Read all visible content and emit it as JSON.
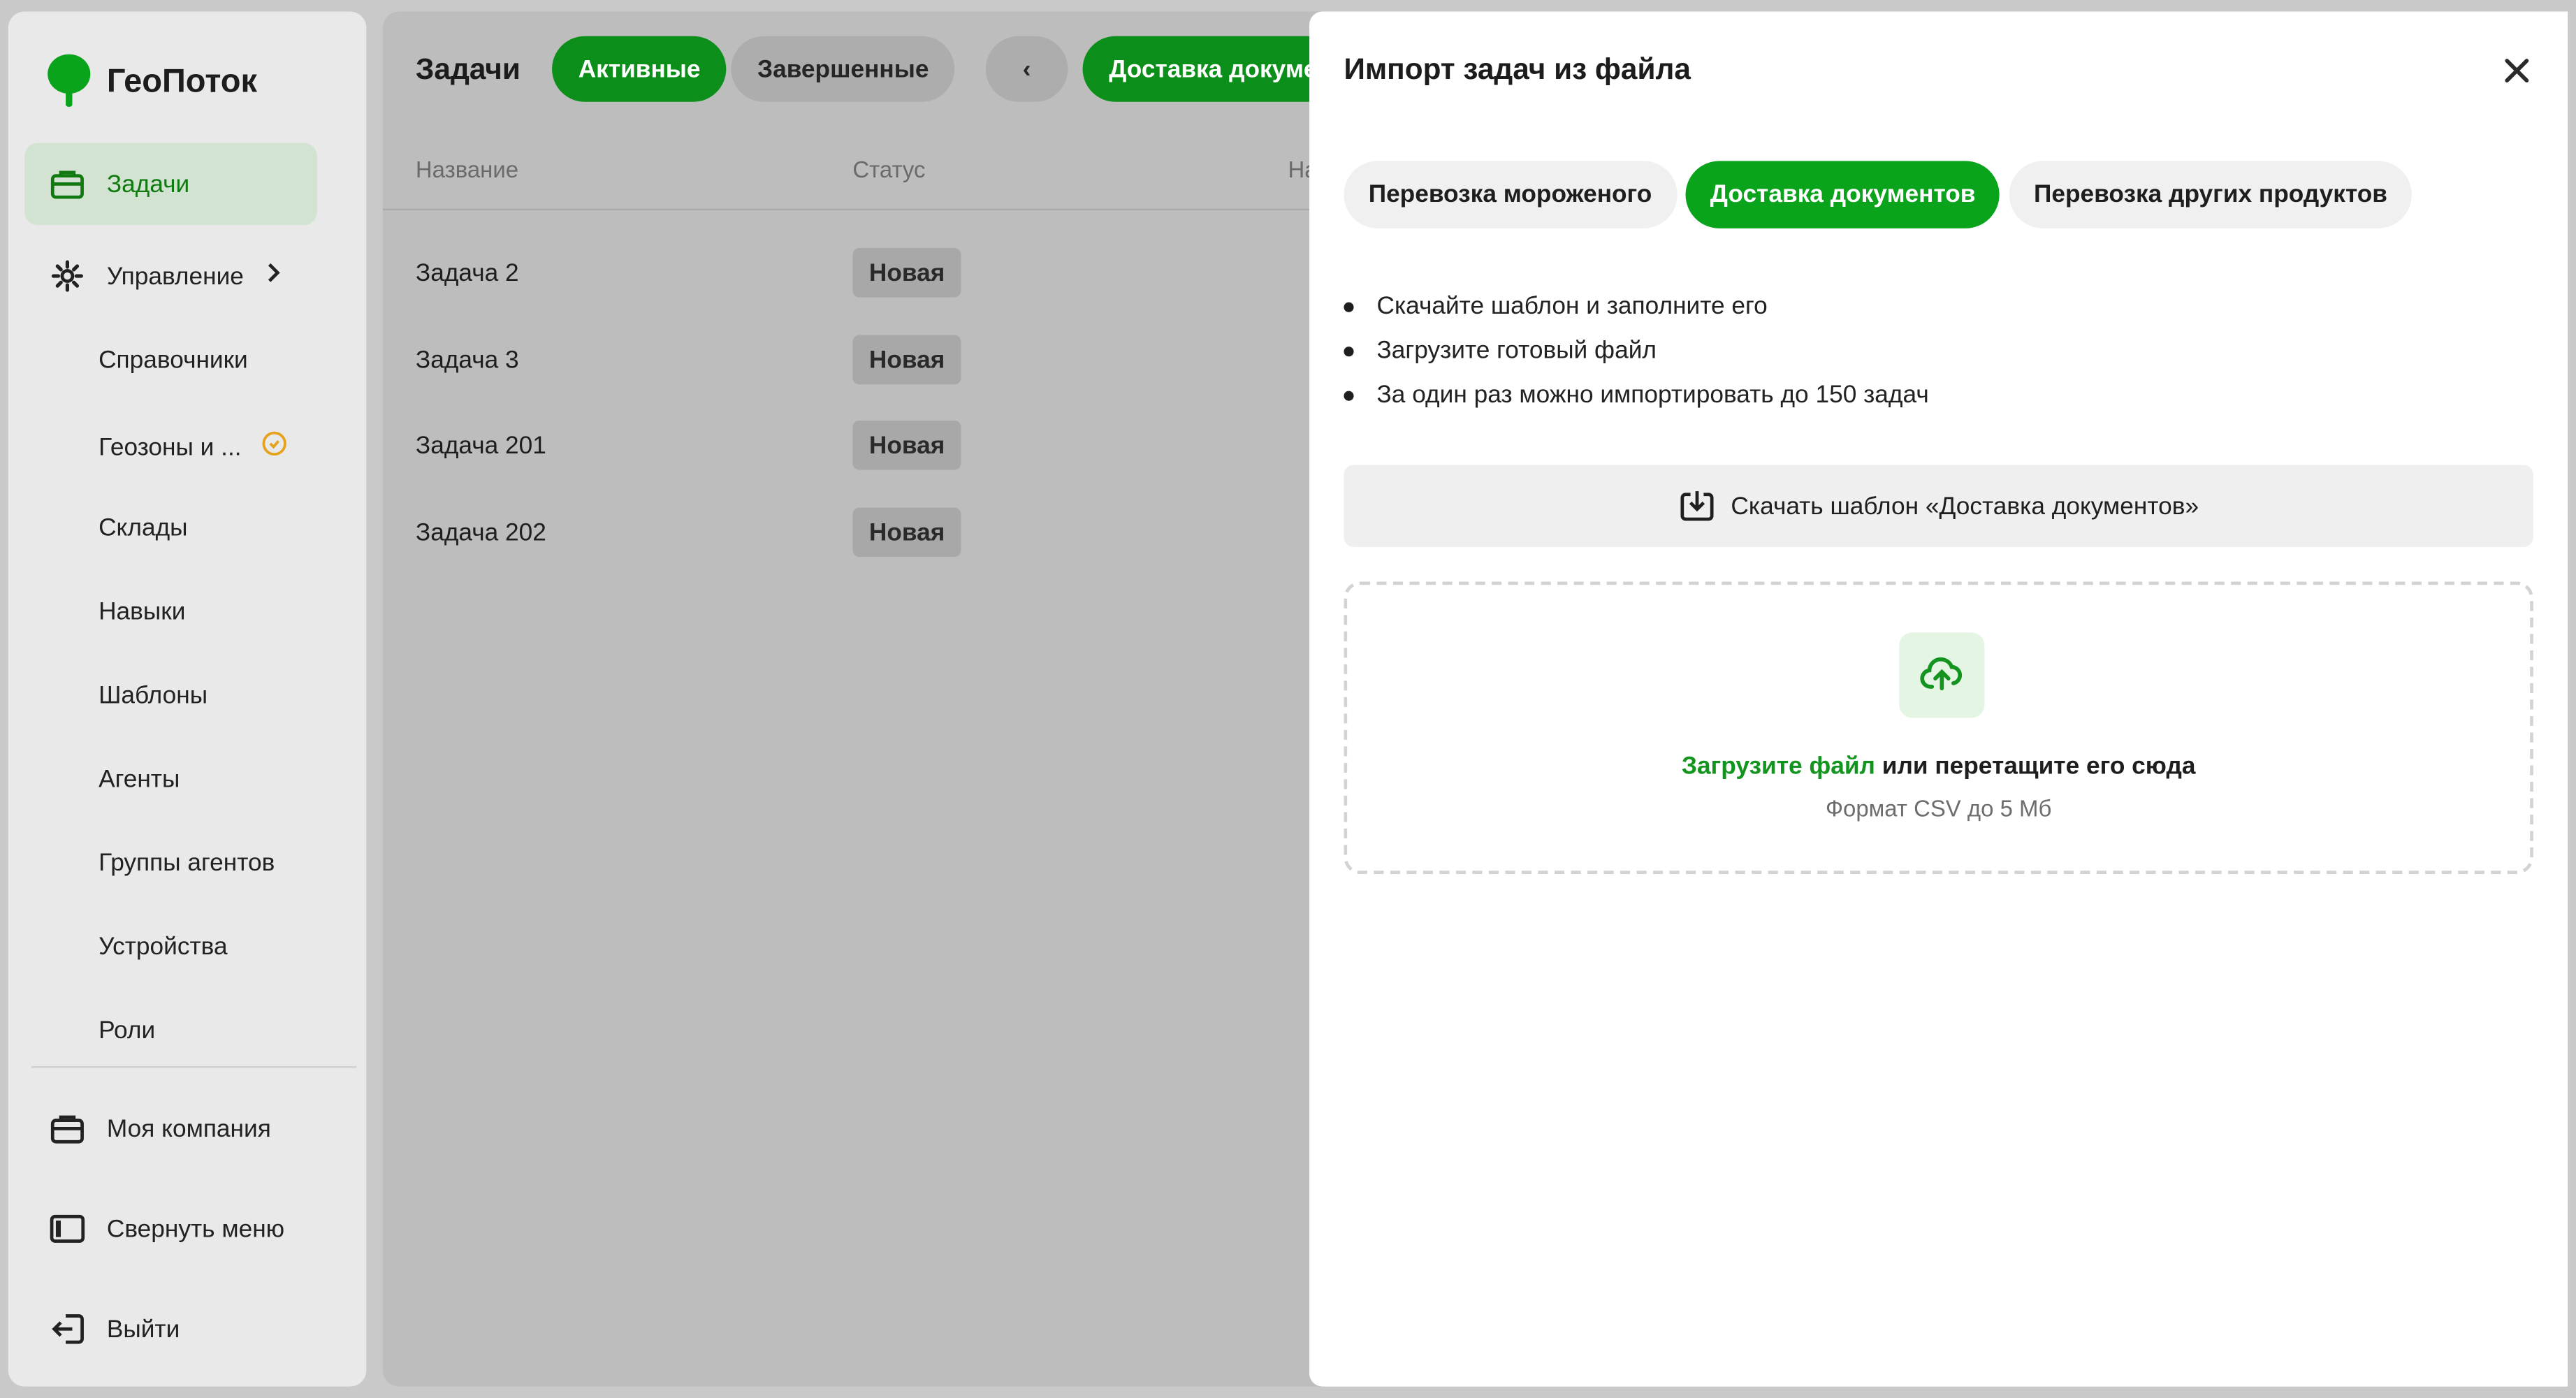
{
  "app": {
    "name": "ГеоПоток"
  },
  "sidebar": {
    "tasks": "Задачи",
    "management": "Управление",
    "sub_items": [
      "Справочники",
      "Геозоны и ...",
      "Склады",
      "Навыки",
      "Шаблоны",
      "Агенты",
      "Группы агентов",
      "Устройства",
      "Роли"
    ],
    "my_company": "Моя компания",
    "collapse": "Свернуть меню",
    "logout": "Выйти"
  },
  "main": {
    "title": "Задачи",
    "tab_active": "Активные",
    "tab_done": "Завершенные",
    "back": "‹",
    "category": "Доставка докуме",
    "columns": {
      "name": "Название",
      "status": "Статус",
      "third": "На"
    },
    "rows": [
      {
        "name": "Задача 2",
        "status": "Новая"
      },
      {
        "name": "Задача 3",
        "status": "Новая"
      },
      {
        "name": "Задача 201",
        "status": "Новая"
      },
      {
        "name": "Задача 202",
        "status": "Новая"
      }
    ]
  },
  "modal": {
    "title": "Импорт задач из файла",
    "tabs": [
      "Перевозка мороженого",
      "Доставка документов",
      "Перевозка других продуктов"
    ],
    "selected_tab": "Доставка документов",
    "bullets": [
      "Скачайте шаблон и заполните его",
      "Загрузите готовый файл",
      "За один раз можно импортировать до 150 задач"
    ],
    "download_label": "Скачать шаблон «Доставка документов»",
    "upload_link": "Загрузите файл",
    "upload_rest": " или перетащите его сюда",
    "upload_hint": "Формат CSV до 5 Мб"
  },
  "colors": {
    "accent": "#0aa31c",
    "accent_dark": "#107a10",
    "warning": "#e5a21c"
  }
}
